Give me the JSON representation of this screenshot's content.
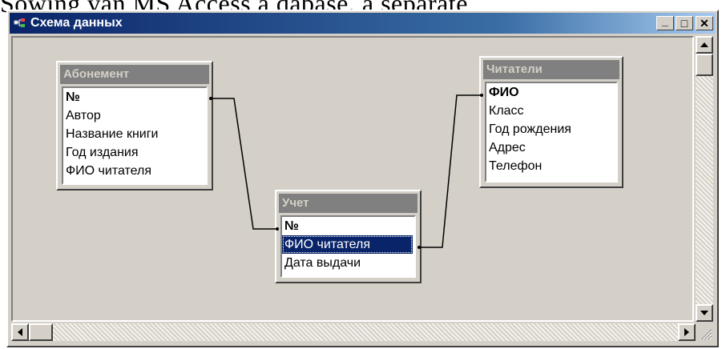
{
  "background_text": "Sowing van MS Access a dabase, a separate",
  "window": {
    "title": "Схема данных",
    "controls": {
      "minimize": "_",
      "maximize": "□",
      "close": "✕"
    }
  },
  "tables": [
    {
      "title": "Абонемент",
      "fields": [
        "№",
        "Автор",
        "Название книги",
        "Год издания",
        "ФИО читателя"
      ],
      "key_index": 0
    },
    {
      "title": "Учет",
      "fields": [
        "№",
        "ФИО читателя",
        "Дата выдачи"
      ],
      "key_index": 0,
      "selected_index": 1
    },
    {
      "title": "Читатели",
      "fields": [
        "ФИО",
        "Класс",
        "Год рождения",
        "Адрес",
        "Телефон"
      ],
      "key_index": 0
    }
  ],
  "colors": {
    "title_active": "#0a246a",
    "face": "#d4d0c8",
    "table_title": "#808080",
    "selection": "#0a246a"
  }
}
